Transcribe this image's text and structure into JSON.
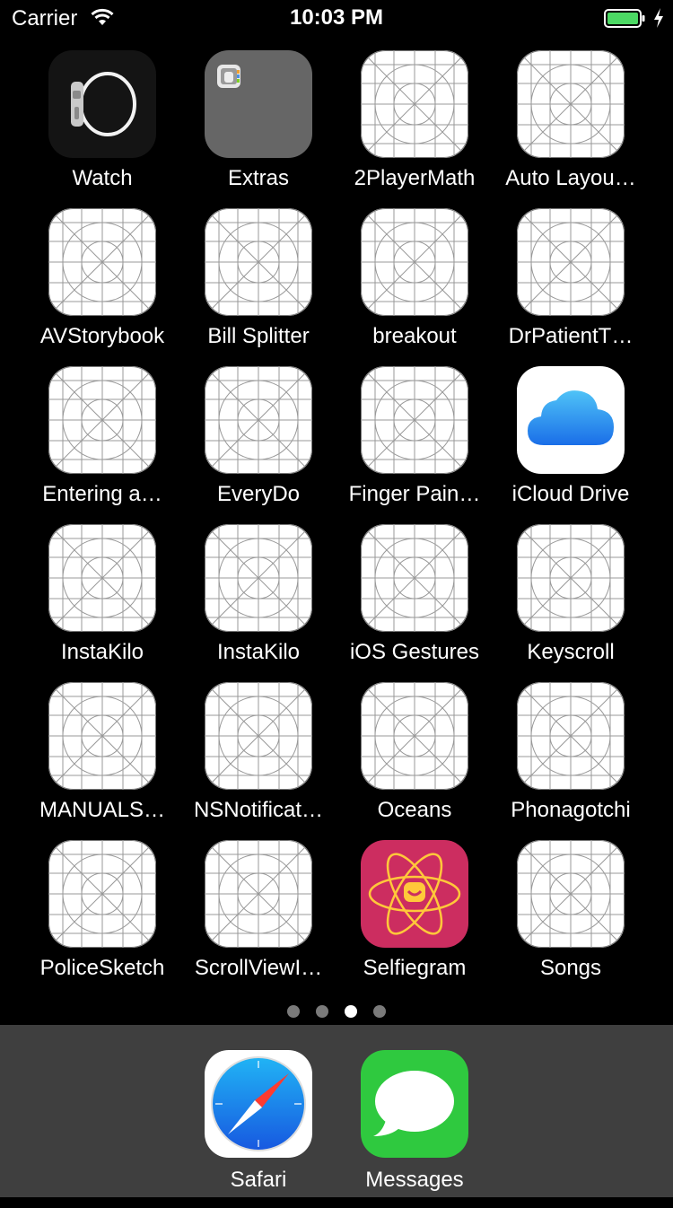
{
  "status_bar": {
    "carrier": "Carrier",
    "time": "10:03 PM",
    "wifi_icon": "wifi-icon",
    "battery_icon": "battery-charging-icon",
    "battery_color": "#4cd964"
  },
  "apps": [
    {
      "label": "Watch",
      "icon": "watch-app-icon"
    },
    {
      "label": "Extras",
      "icon": "folder-icon"
    },
    {
      "label": "2PlayerMath",
      "icon": "placeholder-app-icon"
    },
    {
      "label": "Auto Layou…",
      "icon": "placeholder-app-icon"
    },
    {
      "label": "AVStorybook",
      "icon": "placeholder-app-icon"
    },
    {
      "label": "Bill Splitter",
      "icon": "placeholder-app-icon"
    },
    {
      "label": "breakout",
      "icon": "placeholder-app-icon"
    },
    {
      "label": "DrPatientT…",
      "icon": "placeholder-app-icon"
    },
    {
      "label": "Entering a…",
      "icon": "placeholder-app-icon"
    },
    {
      "label": "EveryDo",
      "icon": "placeholder-app-icon"
    },
    {
      "label": "Finger Pain…",
      "icon": "placeholder-app-icon"
    },
    {
      "label": "iCloud Drive",
      "icon": "icloud-drive-icon"
    },
    {
      "label": "InstaKilo",
      "icon": "placeholder-app-icon"
    },
    {
      "label": "InstaKilo",
      "icon": "placeholder-app-icon"
    },
    {
      "label": "iOS Gestures",
      "icon": "placeholder-app-icon"
    },
    {
      "label": "Keyscroll",
      "icon": "placeholder-app-icon"
    },
    {
      "label": "MANUALS…",
      "icon": "placeholder-app-icon"
    },
    {
      "label": "NSNotificat…",
      "icon": "placeholder-app-icon"
    },
    {
      "label": "Oceans",
      "icon": "placeholder-app-icon"
    },
    {
      "label": "Phonagotchi",
      "icon": "placeholder-app-icon"
    },
    {
      "label": "PoliceSketch",
      "icon": "placeholder-app-icon"
    },
    {
      "label": "ScrollViewI…",
      "icon": "placeholder-app-icon"
    },
    {
      "label": "Selfiegram",
      "icon": "selfiegram-atom-icon"
    },
    {
      "label": "Songs",
      "icon": "placeholder-app-icon"
    }
  ],
  "page_indicator": {
    "pages": 4,
    "current": 3
  },
  "dock": [
    {
      "label": "Safari",
      "icon": "safari-compass-icon"
    },
    {
      "label": "Messages",
      "icon": "messages-bubble-icon"
    }
  ],
  "colors": {
    "background": "#000000",
    "dock_background": "#3f3f3f",
    "selfiegram": "#cc2d60",
    "messages": "#2fc93f",
    "safari_blue": "#1e7cf0"
  }
}
